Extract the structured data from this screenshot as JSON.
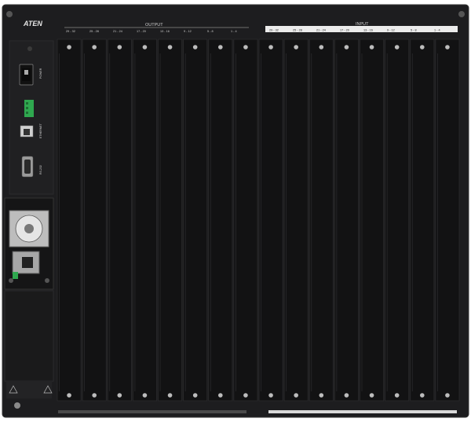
{
  "device": {
    "brand": "ATEN",
    "output_label": "OUTPUT",
    "input_label": "INPUT",
    "output_groups": [
      "29 - 32",
      "25 - 28",
      "21 - 24",
      "17 - 20",
      "13 - 16",
      "9 - 12",
      "5 - 8",
      "1 - 4"
    ],
    "input_groups": [
      "29 - 32",
      "25 - 28",
      "21 - 24",
      "17 - 20",
      "13 - 16",
      "9 - 12",
      "5 - 8",
      "1 - 4"
    ],
    "ports": {
      "power": "POWER",
      "ethernet": "ETHERNET",
      "rs232": "RS-232"
    },
    "colors": {
      "chassis": "#1a1a1c",
      "slot": "#0f0f10",
      "input_bar": "#ececec",
      "terminal_block": "#2fa84f"
    },
    "slot_count": 16
  }
}
